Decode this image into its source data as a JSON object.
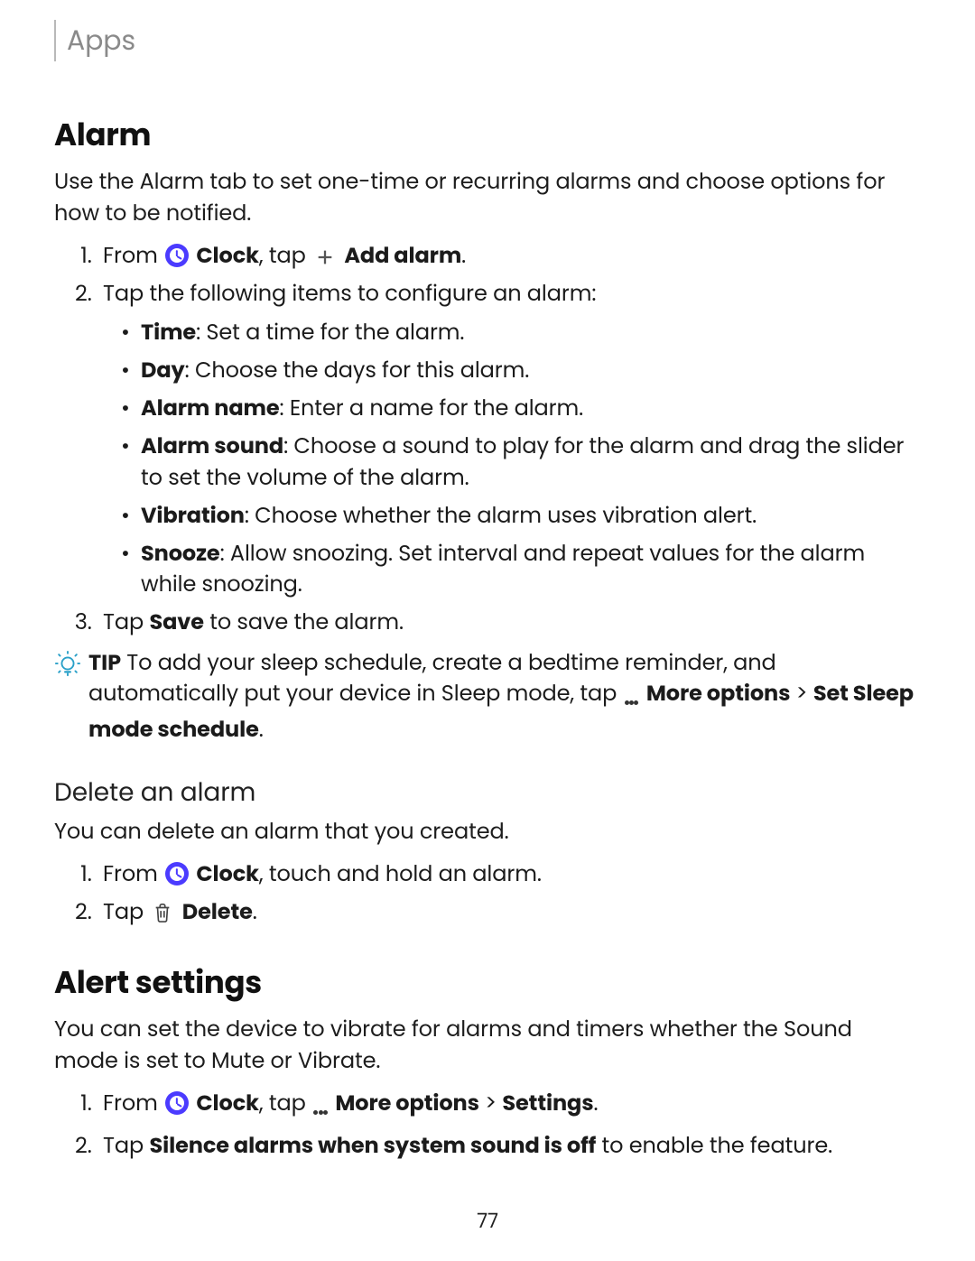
{
  "breadcrumb": "Apps",
  "page_number": "77",
  "alarm": {
    "heading": "Alarm",
    "intro": "Use the Alarm tab to set one-time or recurring alarms and choose options for how to be notified.",
    "step1_pre": "From ",
    "step1_clock": "Clock",
    "step1_mid": ", tap ",
    "step1_add": "Add alarm",
    "step1_post": ".",
    "step2": "Tap the following items to configure an alarm:",
    "opts": {
      "time_b": "Time",
      "time_t": ": Set a time for the alarm.",
      "day_b": "Day",
      "day_t": ": Choose the days for this alarm.",
      "name_b": "Alarm name",
      "name_t": ": Enter a name for the alarm.",
      "sound_b": "Alarm sound",
      "sound_t": ": Choose a sound to play for the alarm and drag the slider to set the volume of the alarm.",
      "vib_b": "Vibration",
      "vib_t": ": Choose whether the alarm uses vibration alert.",
      "snz_b": "Snooze",
      "snz_t": ": Allow snoozing. Set interval and repeat values for the alarm while snoozing."
    },
    "step3_pre": "Tap ",
    "step3_save": "Save",
    "step3_post": " to save the alarm.",
    "tip_label": "TIP",
    "tip_pre": "  To add your sleep schedule, create a bedtime reminder, and automatically put your device in Sleep mode, tap ",
    "tip_more": "More options",
    "tip_gt": " > ",
    "tip_sleep": "Set Sleep mode schedule",
    "tip_post": "."
  },
  "delete": {
    "heading": "Delete an alarm",
    "intro": "You can delete an alarm that you created.",
    "step1_pre": "From ",
    "step1_clock": "Clock",
    "step1_post": ", touch and hold an alarm.",
    "step2_pre": "Tap ",
    "step2_del": "Delete",
    "step2_post": "."
  },
  "alert": {
    "heading": "Alert settings",
    "intro": "You can set the device to vibrate for alarms and timers whether the Sound mode is set to Mute or Vibrate.",
    "step1_pre": "From ",
    "step1_clock": "Clock",
    "step1_mid": ", tap ",
    "step1_more": "More options",
    "step1_gt": " > ",
    "step1_set": "Settings",
    "step1_post": ".",
    "step2_pre": "Tap ",
    "step2_b": "Silence alarms when system sound is off",
    "step2_post": " to enable the feature."
  }
}
